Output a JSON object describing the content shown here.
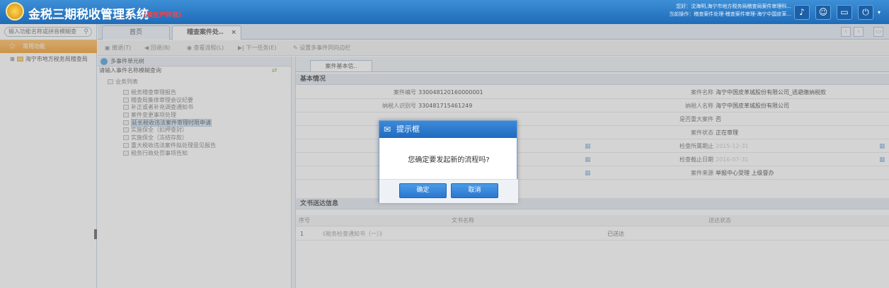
{
  "header": {
    "title": "金税三期税收管理系统",
    "env": "(模生产环境)",
    "user_line1": "您好：沈海明,海宁市地方税务局稽查局案件审理科...",
    "user_line2": "当前操作：稽查案件处理-稽查案件审理-海宁中国皮革..."
  },
  "sidebar": {
    "search_placeholder": "输入功能名称或拼音模糊查",
    "favorites": "常用功能",
    "tree_root": "海宁市地方税务局稽查局"
  },
  "tabs": [
    {
      "label": "首页"
    },
    {
      "label": "稽查案件处.."
    }
  ],
  "toolbar": {
    "items": [
      "撤退(T)",
      "回退(B)",
      "查看流程(L)",
      "下一任务(E)",
      "设置多事件同向边栏"
    ]
  },
  "left_panel": {
    "title": "多事件单元树",
    "search_hint": "请输入事件名称模糊查询",
    "list_root": "业务列表",
    "items": [
      "税务稽查审理报告",
      "稽查局集体审理会议纪要",
      "补正或者补充调查通知书",
      "案件变更事项处理",
      "延长税收违法案件审理时限申请",
      "实施保全（扣押查封）",
      "实施保全（冻结存款）",
      "重大税收违法案件拟处理意见报告",
      "税务行政处罚事项告知"
    ],
    "selected_index": 4
  },
  "main": {
    "subtab": "案件基本信..",
    "basic_title": "基本情况",
    "fields": {
      "case_no_label": "案件编号",
      "case_no": "330048120160000001",
      "case_name_label": "案件名称",
      "case_name": "海宁中国皮革城股份有限公司_逃避缴纳税款",
      "taxpayer_id_label": "纳税人识别号",
      "taxpayer_id": "330481715461249",
      "taxpayer_name_label": "纳税人名称",
      "taxpayer_name": "海宁中国皮革城股份有限公司",
      "major_label": "是否重大案件",
      "major": "否",
      "status_label": "案件状态",
      "status": "正在审理",
      "period_start_label": "检查所属期止",
      "period_start": "2015-12-31",
      "period_end_label": "检查截止日期",
      "period_end": "2016-07-31",
      "source_label": "案件来源",
      "source": "举报中心受理 上级督办"
    },
    "doc_title": "文书送达信息",
    "doc_headers": [
      "序号",
      "文书名称",
      "送达状态"
    ],
    "doc_rows": [
      {
        "no": "1",
        "name": "《税务检查通知书（一）》",
        "status": "已送达"
      }
    ]
  },
  "dialog": {
    "title": "提示框",
    "message": "您确定要发起新的流程吗?",
    "ok": "确定",
    "cancel": "取消"
  }
}
